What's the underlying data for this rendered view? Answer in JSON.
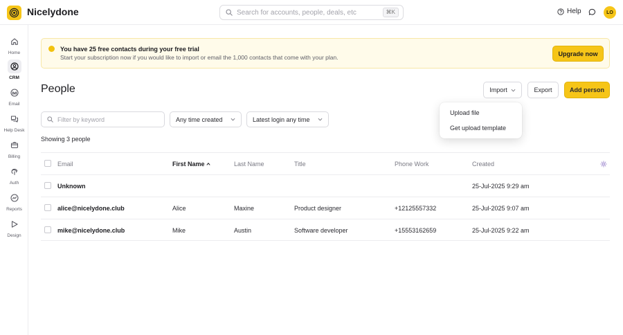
{
  "app": {
    "name": "Nicelydone",
    "user_initials": "LO"
  },
  "search": {
    "placeholder": "Search for accounts, people, deals, etc",
    "shortcut": "⌘K"
  },
  "header": {
    "help_label": "Help"
  },
  "sidebar": {
    "items": [
      {
        "label": "Home",
        "icon": "home-icon",
        "active": false
      },
      {
        "label": "CRM",
        "icon": "crm-icon",
        "active": true
      },
      {
        "label": "Email",
        "icon": "email-icon",
        "active": false
      },
      {
        "label": "Help Desk",
        "icon": "helpdesk-icon",
        "active": false
      },
      {
        "label": "Billing",
        "icon": "billing-icon",
        "active": false
      },
      {
        "label": "Auth",
        "icon": "auth-icon",
        "active": false
      },
      {
        "label": "Reports",
        "icon": "reports-icon",
        "active": false
      },
      {
        "label": "Design",
        "icon": "design-icon",
        "active": false
      }
    ]
  },
  "banner": {
    "title": "You have 25 free contacts during your free trial",
    "text": "Start your subscription now if you would like to import or email the 1,000 contacts that come with your plan.",
    "button": "Upgrade now"
  },
  "page": {
    "title": "People",
    "import_label": "Import",
    "export_label": "Export",
    "add_label": "Add person"
  },
  "import_menu": {
    "items": [
      "Upload file",
      "Get upload template"
    ]
  },
  "filters": {
    "keyword_placeholder": "Filter by keyword",
    "created": "Any time created",
    "login": "Latest login any time",
    "showing": "Showing 3 people"
  },
  "table": {
    "columns": [
      "Email",
      "First Name",
      "Last Name",
      "Title",
      "Phone Work",
      "Created"
    ],
    "sort_column": "First Name",
    "rows": [
      {
        "email": "Unknown",
        "first": "",
        "last": "",
        "title": "",
        "phone": "",
        "created": "25-Jul-2025 9:29 am"
      },
      {
        "email": "alice@nicelydone.club",
        "first": "Alice",
        "last": "Maxine",
        "title": "Product designer",
        "phone": "+12125557332",
        "created": "25-Jul-2025 9:07 am"
      },
      {
        "email": "mike@nicelydone.club",
        "first": "Mike",
        "last": "Austin",
        "title": "Software developer",
        "phone": "+15553162659",
        "created": "25-Jul-2025 9:22 am"
      }
    ]
  },
  "colors": {
    "accent": "#f6c518",
    "banner_bg": "#fffbea"
  }
}
